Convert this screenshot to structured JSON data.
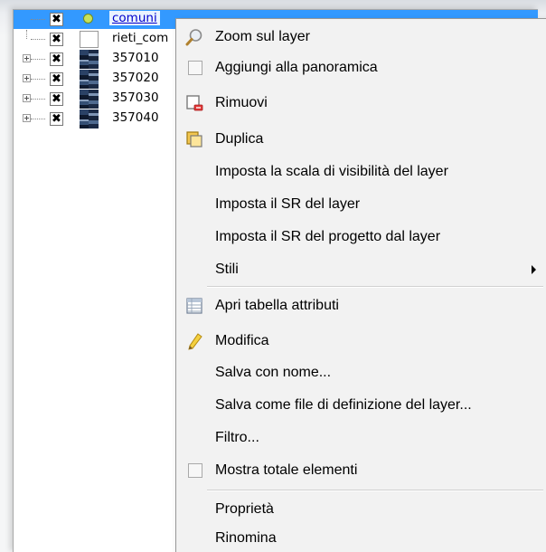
{
  "layers": [
    {
      "name": "comuni",
      "checked": "✖",
      "selected": true,
      "icon": "vector-point-icon"
    },
    {
      "name": "rieti_com",
      "checked": "✖",
      "selected": false,
      "icon": "vector-polygon-icon"
    },
    {
      "name": "357010",
      "checked": "✖",
      "selected": false,
      "icon": "raster-icon"
    },
    {
      "name": "357020",
      "checked": "✖",
      "selected": false,
      "icon": "raster-icon"
    },
    {
      "name": "357030",
      "checked": "✖",
      "selected": false,
      "icon": "raster-icon"
    },
    {
      "name": "357040",
      "checked": "✖",
      "selected": false,
      "icon": "raster-icon"
    }
  ],
  "menu": {
    "zoom_layer": "Zoom sul layer",
    "add_overview": "Aggiungi alla panoramica",
    "remove": "Rimuovi",
    "duplicate": "Duplica",
    "set_scale_visibility": "Imposta la scala di visibilità del layer",
    "set_layer_crs": "Imposta il SR del layer",
    "set_project_crs": "Imposta il SR del progetto dal layer",
    "styles": "Stili",
    "open_attribute_table": "Apri tabella attributi",
    "edit": "Modifica",
    "save_as": "Salva con nome...",
    "save_definition": "Salva come file di definizione del layer...",
    "filter": "Filtro...",
    "show_feature_count": "Mostra totale elementi",
    "properties": "Proprietà",
    "rename": "Rinomina"
  },
  "colors": {
    "selection": "#3399ff",
    "menu_background": "#f2f2f2"
  }
}
